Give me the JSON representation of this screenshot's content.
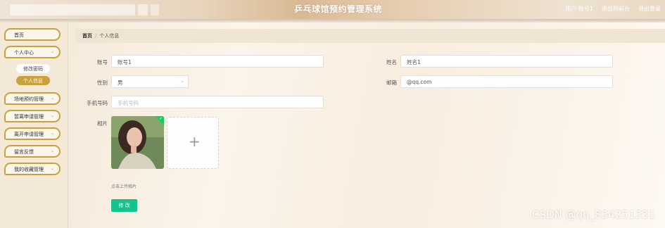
{
  "header": {
    "title": "乒乓球馆预约管理系统",
    "user_label": "用户 账号1",
    "front_label": "退出到前台",
    "logout_label": "退出登录"
  },
  "sidebar": {
    "items": [
      {
        "label": "首页"
      },
      {
        "label": "个人中心"
      },
      {
        "label": "场地预约管理"
      },
      {
        "label": "暂离申请管理"
      },
      {
        "label": "离开申请管理"
      },
      {
        "label": "留言反馈"
      },
      {
        "label": "我的收藏管理"
      }
    ],
    "sub_items": [
      {
        "label": "修改密码"
      },
      {
        "label": "个人信息"
      }
    ]
  },
  "breadcrumb": {
    "home": "首页",
    "separator": "/",
    "current": "个人信息"
  },
  "form": {
    "account_label": "账号",
    "account_value": "账号1",
    "name_label": "姓名",
    "name_value": "姓名1",
    "gender_label": "性别",
    "gender_value": "男",
    "email_label": "邮箱",
    "email_value": "@qq.com",
    "phone_label": "手机号码",
    "phone_placeholder": "手机号码",
    "photo_label": "相片",
    "upload_hint": "点击上传相片",
    "submit_label": "修 改"
  },
  "watermark": "CSDN @qq_834251331",
  "colors": {
    "accent": "#c9a23c",
    "submit": "#13c28c",
    "success": "#13ce66"
  }
}
